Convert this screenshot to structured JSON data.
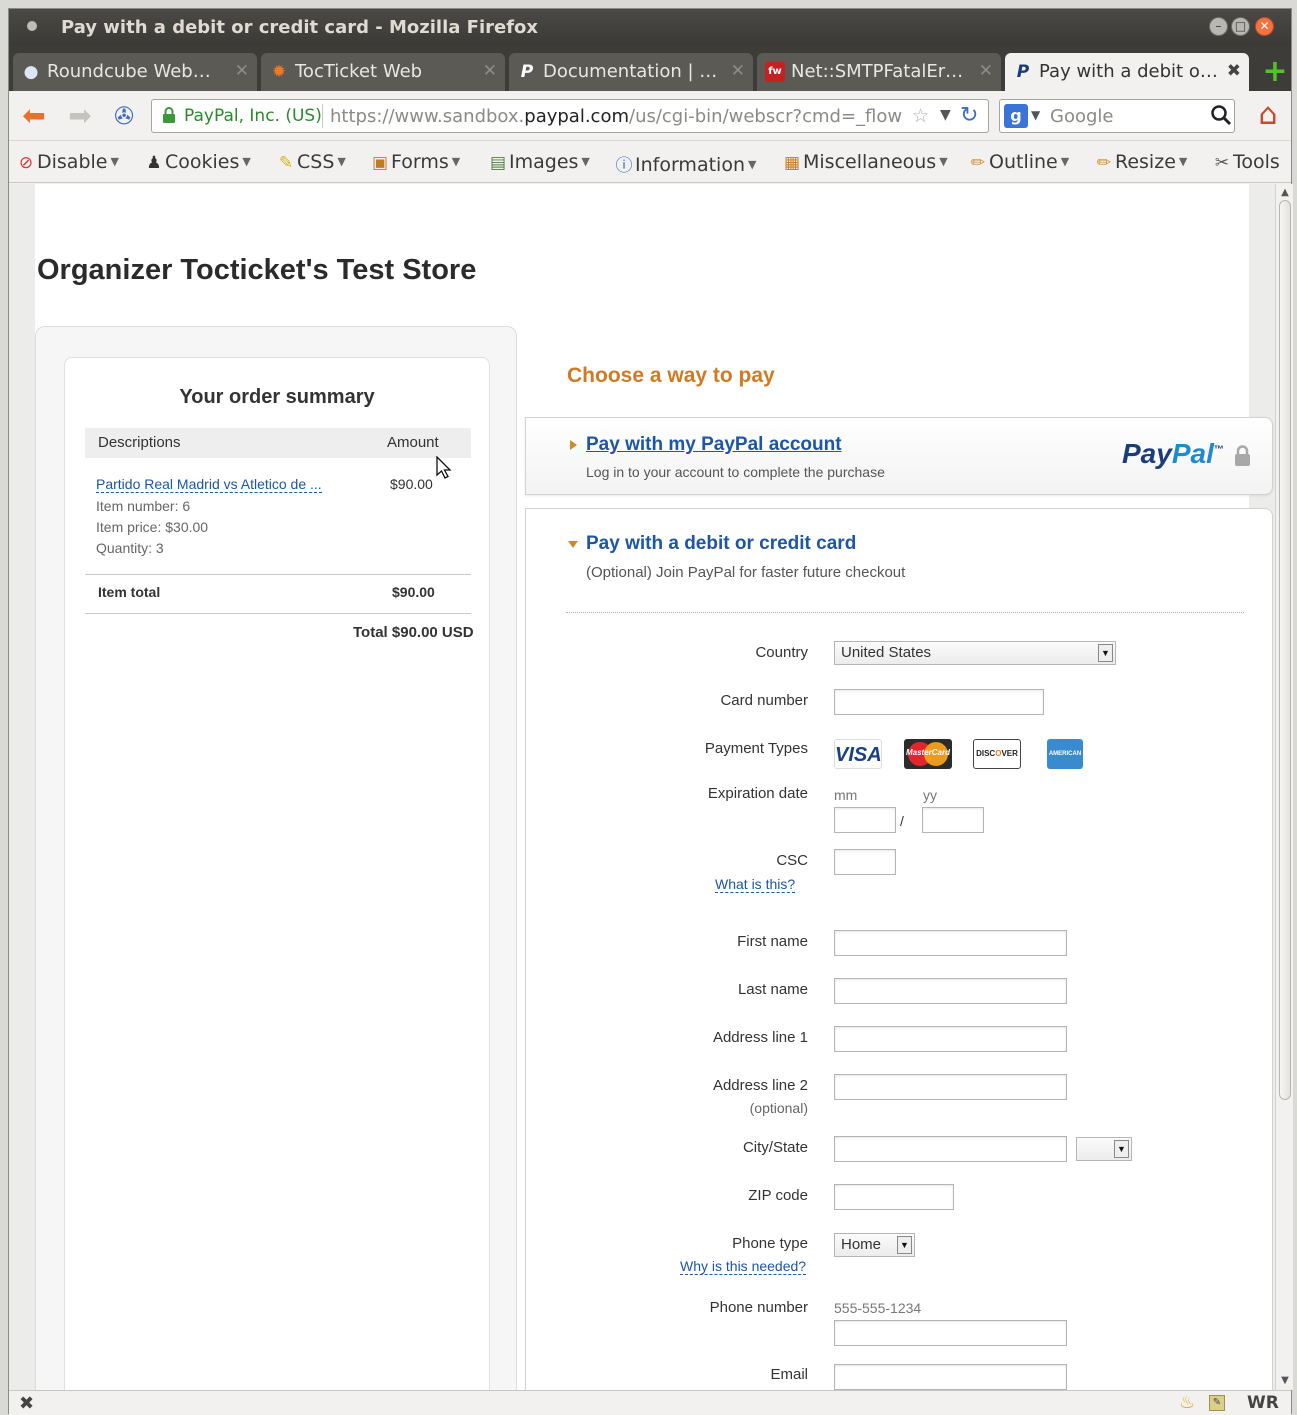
{
  "window": {
    "title": "Pay with a debit or credit card - Mozilla Firefox"
  },
  "tabs": [
    {
      "label": "Roundcube Web…",
      "icon": "roundcube-icon"
    },
    {
      "label": "TocTicket Web",
      "icon": "tocticket-icon"
    },
    {
      "label": "Documentation | …",
      "icon": "paypal-p-icon"
    },
    {
      "label": "Net::SMTPFatalEr…",
      "icon": "fw-icon"
    },
    {
      "label": "Pay with a debit o…",
      "icon": "paypal-p-icon",
      "active": true
    }
  ],
  "navbar": {
    "identity": "PayPal, Inc. (US)",
    "url_prefix": "https://www.sandbox.",
    "url_domain": "paypal.com",
    "url_rest": "/us/cgi-bin/webscr?cmd=_flow",
    "search_placeholder": "Google"
  },
  "devbar": {
    "items": [
      "Disable",
      "Cookies",
      "CSS",
      "Forms",
      "Images",
      "Information",
      "Miscellaneous",
      "Outline",
      "Resize",
      "Tools"
    ]
  },
  "page": {
    "store_title": "Organizer Tocticket's Test Store",
    "summary": {
      "title": "Your order summary",
      "col_desc": "Descriptions",
      "col_amount": "Amount",
      "item_name": "Partido Real Madrid vs Atletico de ...",
      "item_amount": "$90.00",
      "item_number": "Item number: 6",
      "item_price": "Item price: $30.00",
      "item_qty": "Quantity: 3",
      "item_total_label": "Item total",
      "item_total_value": "$90.00",
      "total_line": "Total $90.00 USD"
    },
    "choose_title": "Choose a way to pay",
    "paypal_option": {
      "link": "Pay with my PayPal account",
      "sub": "Log in to your account to complete the purchase",
      "logo_a": "Pay",
      "logo_b": "Pal",
      "logo_tm": "™"
    },
    "card_option": {
      "title": "Pay with a debit or credit card",
      "sub": "(Optional) Join PayPal for faster future checkout"
    },
    "form": {
      "country_label": "Country",
      "country_value": "United States",
      "card_number_label": "Card number",
      "payment_types_label": "Payment Types",
      "card_visa": "VISA",
      "card_mc": "MasterCard",
      "card_disc_a": "DISC",
      "card_disc_b": "O",
      "card_disc_c": "VER",
      "card_amex": "AMERICAN EXPRESS",
      "expiration_label": "Expiration date",
      "mm": "mm",
      "yy": "yy",
      "slash": "/",
      "csc_label": "CSC",
      "csc_help": "What is this?",
      "first_name_label": "First name",
      "last_name_label": "Last name",
      "address1_label": "Address line 1",
      "address2_label": "Address line 2",
      "optional": "(optional)",
      "city_state_label": "City/State",
      "zip_label": "ZIP code",
      "phone_type_label": "Phone type",
      "phone_type_value": "Home",
      "phone_help": "Why is this needed?",
      "phone_number_label": "Phone number",
      "phone_hint": "555-555-1234",
      "email_label": "Email"
    }
  },
  "statusbar": {
    "wr": "WR"
  },
  "colors": {
    "link_blue": "#1d56a5",
    "accent_orange": "#d07b24",
    "paypal_dark": "#1b3d7a",
    "paypal_light": "#1e8bd1"
  }
}
